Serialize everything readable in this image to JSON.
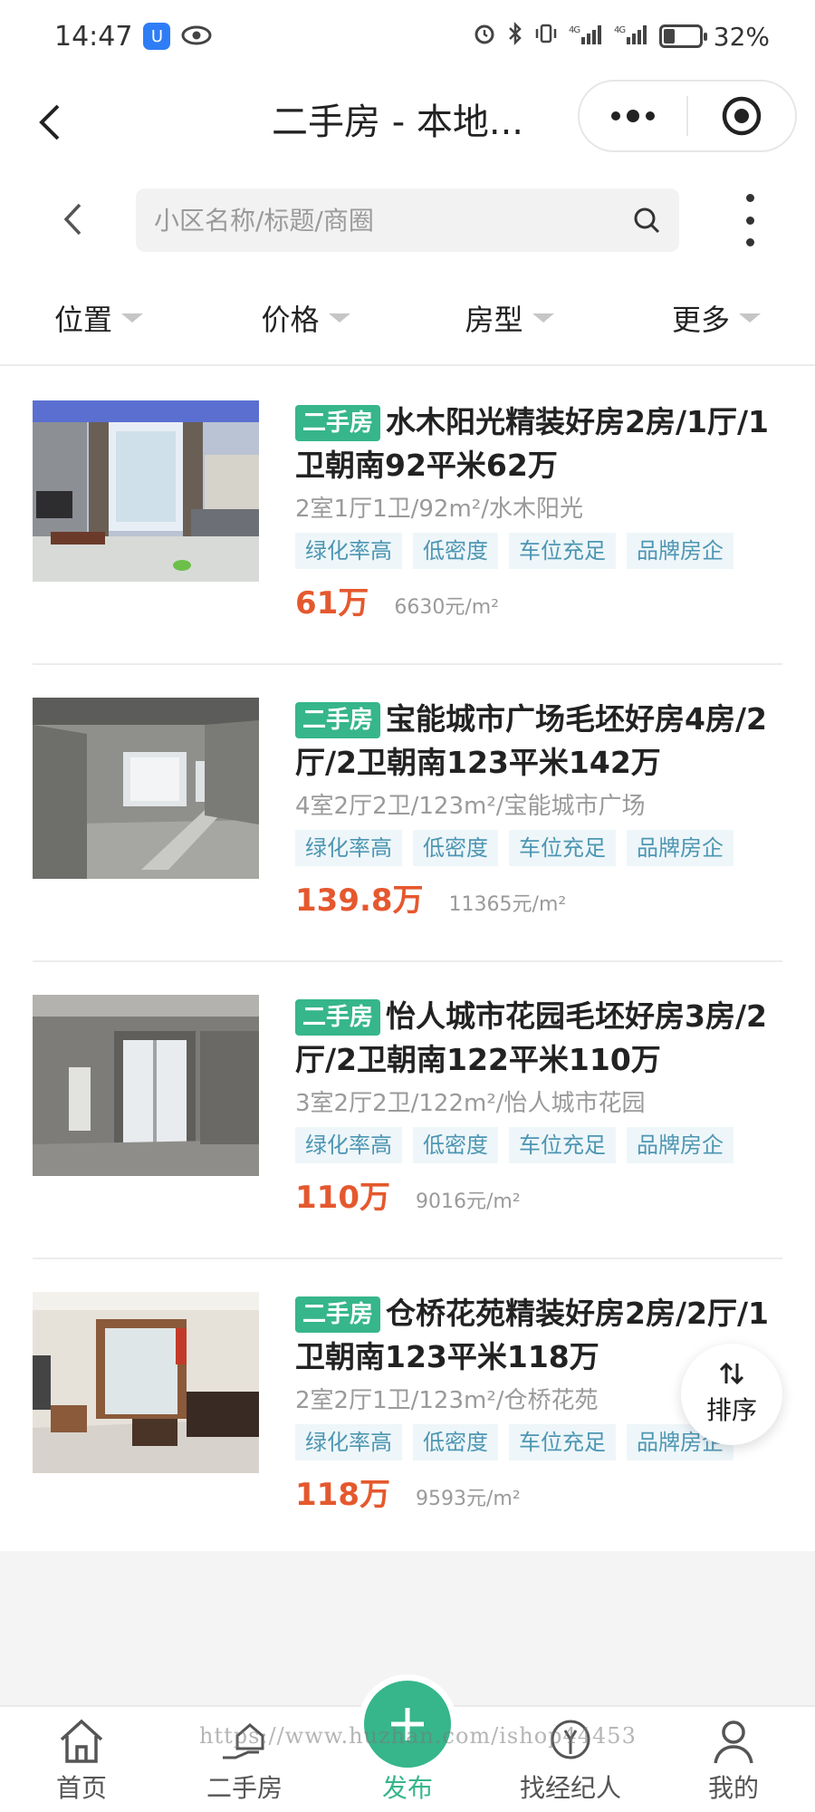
{
  "status_bar": {
    "time": "14:47",
    "battery": "32%",
    "battery_level": 0.32
  },
  "header": {
    "title": "二手房 - 本地..."
  },
  "search": {
    "placeholder": "小区名称/标题/商圈"
  },
  "filters": [
    {
      "label": "位置"
    },
    {
      "label": "价格"
    },
    {
      "label": "房型"
    },
    {
      "label": "更多"
    }
  ],
  "listings": [
    {
      "type": "二手房",
      "title": "水木阳光精装好房2房/1厅/1卫朝南92平米62万",
      "spec": "2室1厅1卫/92m²/水木阳光",
      "tags": [
        "绿化率高",
        "低密度",
        "车位充足",
        "品牌房企"
      ],
      "price": "61万",
      "unit_price": "6630元/m²"
    },
    {
      "type": "二手房",
      "title": "宝能城市广场毛坯好房4房/2厅/2卫朝南123平米142万",
      "spec": "4室2厅2卫/123m²/宝能城市广场",
      "tags": [
        "绿化率高",
        "低密度",
        "车位充足",
        "品牌房企"
      ],
      "price": "139.8万",
      "unit_price": "11365元/m²"
    },
    {
      "type": "二手房",
      "title": "怡人城市花园毛坯好房3房/2厅/2卫朝南122平米110万",
      "spec": "3室2厅2卫/122m²/怡人城市花园",
      "tags": [
        "绿化率高",
        "低密度",
        "车位充足",
        "品牌房企"
      ],
      "price": "110万",
      "unit_price": "9016元/m²"
    },
    {
      "type": "二手房",
      "title": "仓桥花苑精装好房2房/2厅/1卫朝南123平米118万",
      "spec": "2室2厅1卫/123m²/仓桥花苑",
      "tags": [
        "绿化率高",
        "低密度",
        "车位充足",
        "品牌房企"
      ],
      "price": "118万",
      "unit_price": "9593元/m²"
    }
  ],
  "sort_button": {
    "label": "排序"
  },
  "tabbar": [
    {
      "label": "首页"
    },
    {
      "label": "二手房"
    },
    {
      "label": "发布"
    },
    {
      "label": "找经纪人"
    },
    {
      "label": "我的"
    }
  ],
  "watermark": "https://www.huzhan.com/ishop44453",
  "colors": {
    "accent_green": "#36b68a",
    "price_red": "#e5582e",
    "tag_text": "#4d96b3",
    "tag_bg": "#eef6f9"
  }
}
